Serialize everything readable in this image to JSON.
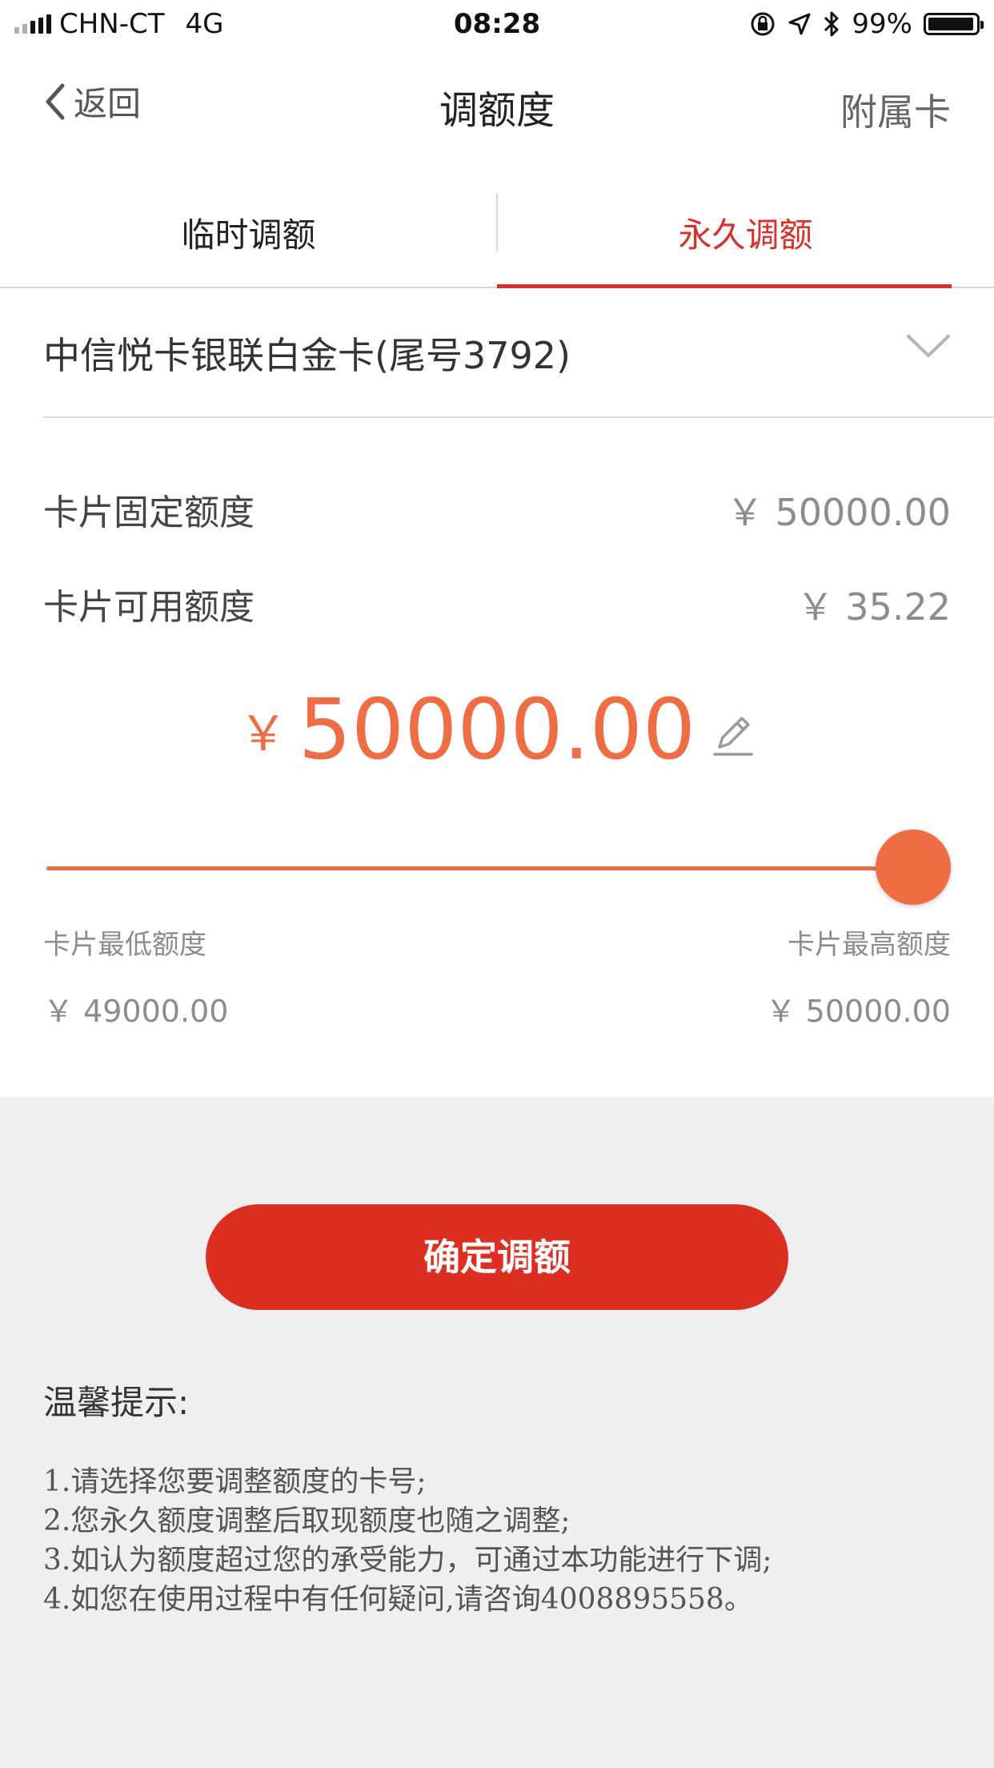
{
  "status_bar": {
    "carrier": "CHN-CT",
    "network": "4G",
    "time": "08:28",
    "battery": "99%"
  },
  "nav": {
    "back_label": "返回",
    "title": "调额度",
    "right_label": "附属卡"
  },
  "tabs": [
    {
      "label": "临时调额",
      "active": false
    },
    {
      "label": "永久调额",
      "active": true
    }
  ],
  "card": {
    "name": "中信悦卡银联白金卡(尾号3792)"
  },
  "limits": {
    "fixed_label": "卡片固定额度",
    "fixed_value": "￥ 50000.00",
    "available_label": "卡片可用额度",
    "available_value": "￥ 35.22"
  },
  "adjust": {
    "currency": "￥",
    "amount": "50000.00",
    "slider_fraction": 1.0,
    "min_label": "卡片最低额度",
    "max_label": "卡片最高额度",
    "min_value": "￥ 49000.00",
    "max_value": "￥ 50000.00"
  },
  "confirm_label": "确定调额",
  "tips": {
    "title": "温馨提示:",
    "lines": [
      "1.请选择您要调整额度的卡号;",
      "2.您永久额度调整后取现额度也随之调整;",
      "3.如认为额度超过您的承受能力，可通过本功能进行下调;",
      "4.如您在使用过程中有任何疑问,请咨询4008895558。"
    ]
  },
  "colors": {
    "accent_red": "#dc2f22",
    "amount_orange": "#ee6d44",
    "tab_active": "#d9302a"
  }
}
